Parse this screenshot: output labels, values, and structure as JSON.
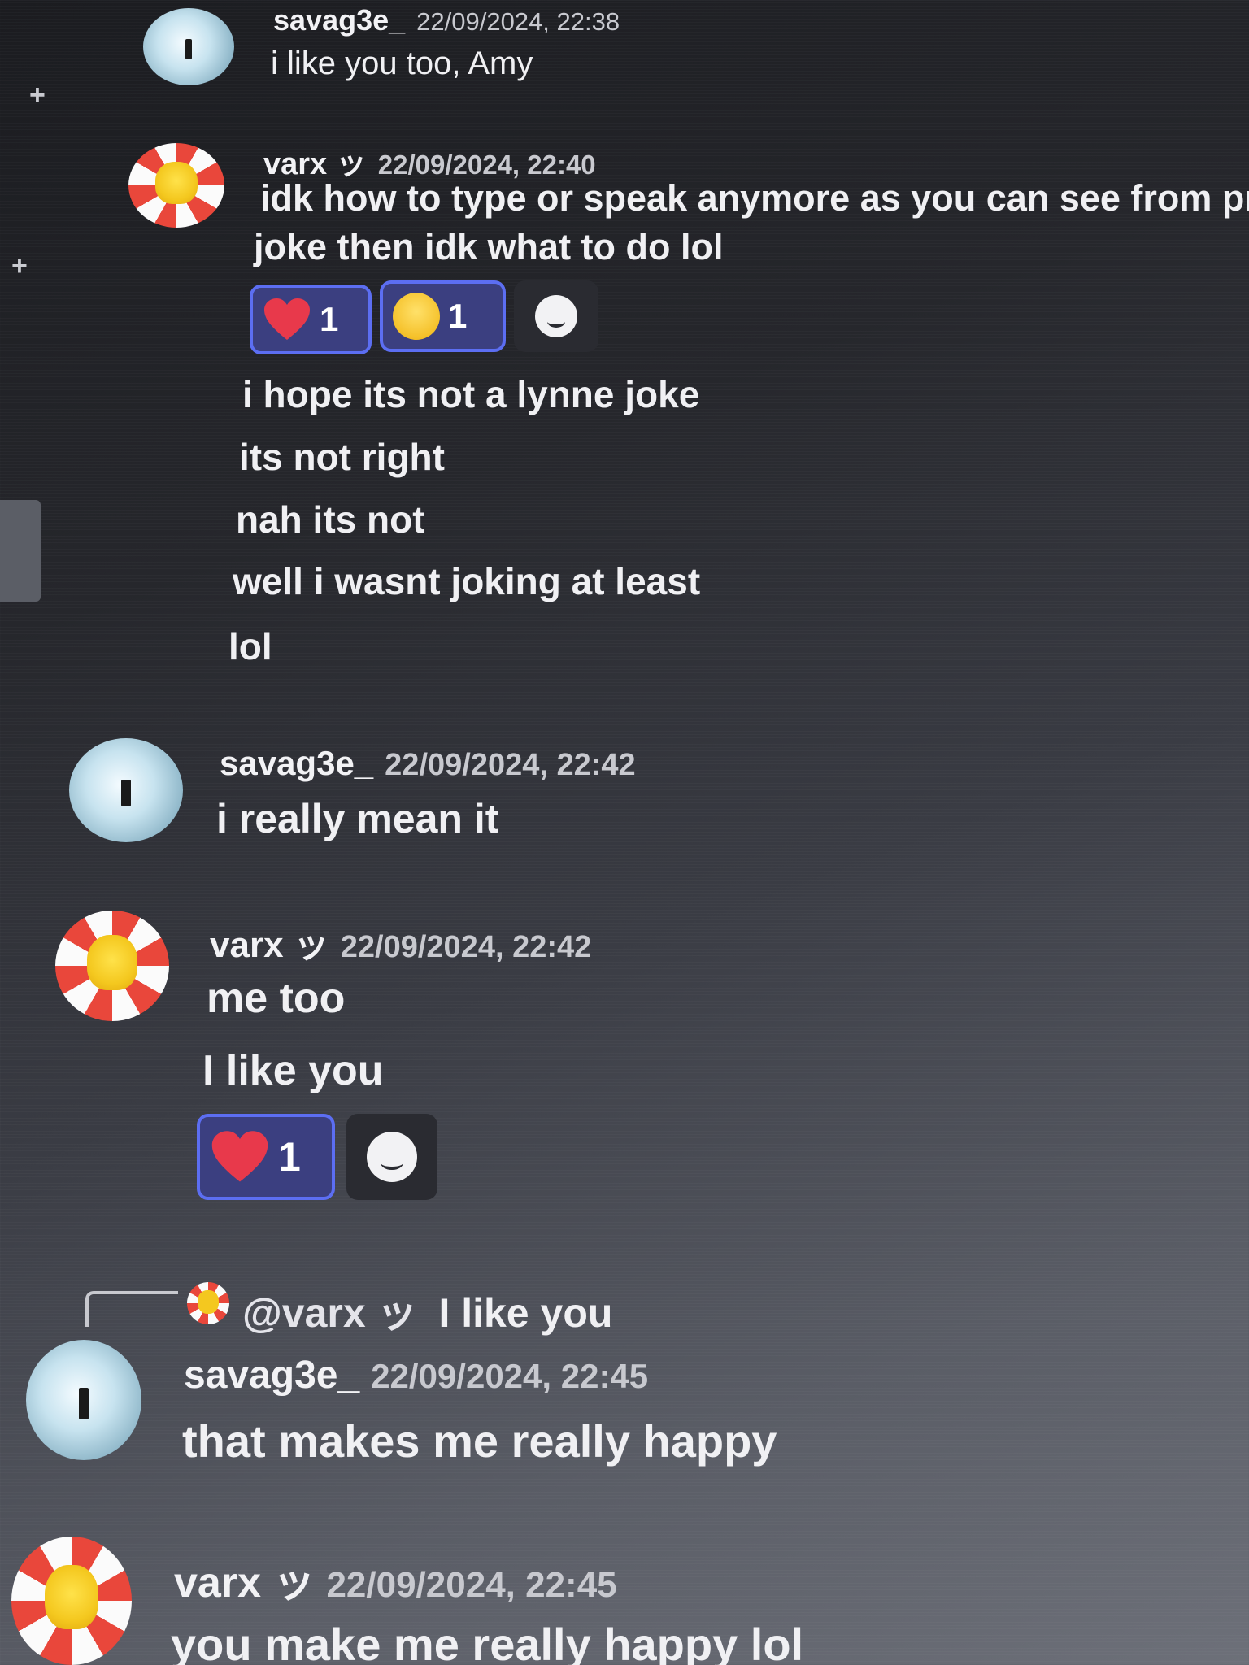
{
  "messages": [
    {
      "author": "savag3e_",
      "time": "22/09/2024, 22:38",
      "lines": [
        "i like you too, Amy"
      ]
    },
    {
      "author": "varx ッ",
      "time": "22/09/2024, 22:40",
      "lines": [
        "idk how to type or speak anymore as you can see from prev",
        "joke then idk what to do lol"
      ],
      "reactions": [
        {
          "emoji": "heart-icon",
          "count": "1"
        },
        {
          "emoji": "laughing-emoji-icon",
          "count": "1"
        }
      ]
    },
    {
      "author": "",
      "time": "",
      "lines": [
        "i hope its not a lynne joke",
        "its not right",
        "nah its not",
        "well i wasnt joking at least",
        "lol"
      ]
    },
    {
      "author": "savag3e_",
      "time": "22/09/2024, 22:42",
      "lines": [
        "i really mean it"
      ]
    },
    {
      "author": "varx ッ",
      "time": "22/09/2024, 22:42",
      "lines": [
        "me too",
        "I like you"
      ],
      "reactions": [
        {
          "emoji": "heart-icon",
          "count": "1"
        }
      ]
    },
    {
      "author": "savag3e_",
      "time": "22/09/2024, 22:45",
      "lines": [
        "that makes me really happy"
      ],
      "reply_to": {
        "mention": "@varx ッ",
        "text": "I like you"
      }
    },
    {
      "author": "varx ッ",
      "time": "22/09/2024, 22:45",
      "lines": [
        "you make me really happy lol"
      ]
    }
  ],
  "sidebar": {
    "plus_label": "+"
  },
  "colors": {
    "reaction_border": "#5c6ef2",
    "reaction_bg": "#3b3f80",
    "heart": "#e8394b"
  }
}
